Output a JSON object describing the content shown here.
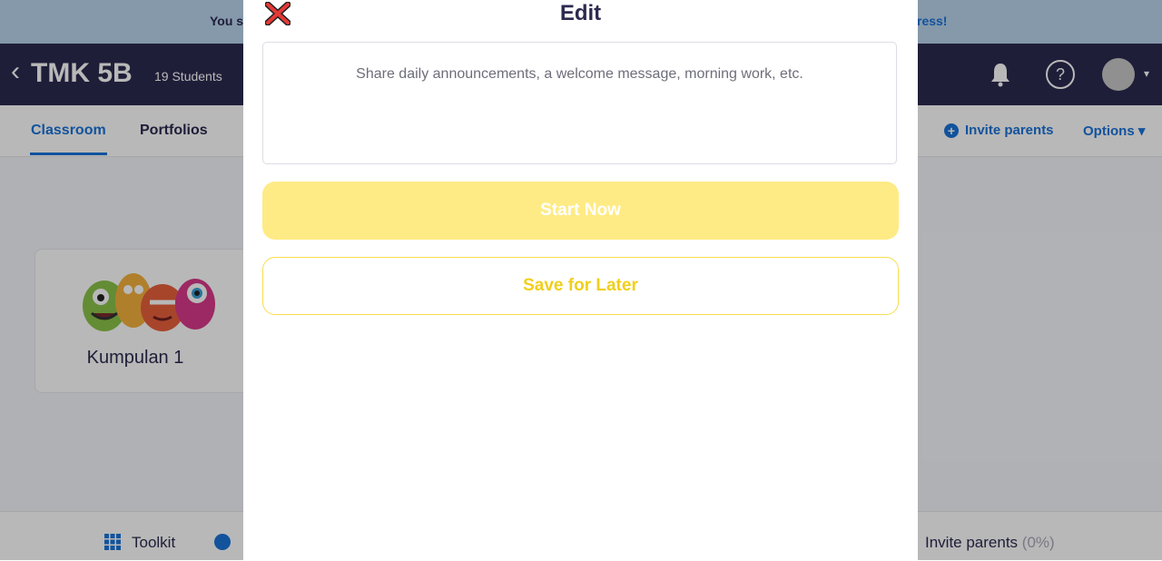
{
  "banner": {
    "left_text": "You s",
    "right_link": "ress!"
  },
  "header": {
    "back_icon": "chevron-left-icon",
    "back_glyph": "‹",
    "class_name": "TMK 5B",
    "students": "19 Students",
    "help_glyph": "?",
    "avatar_caret": "▾"
  },
  "nav": {
    "tabs": [
      {
        "label": "Classroom",
        "active": true
      },
      {
        "label": "Portfolios",
        "active": false
      }
    ],
    "invite_icon_glyph": "+",
    "invite_parents": "Invite parents",
    "options": "Options ▾"
  },
  "groups": [
    {
      "label": "Kumpulan 1",
      "icon": "monsters-group-icon"
    }
  ],
  "footer": {
    "toolkit": "Toolkit",
    "invite_parents": "Invite parents",
    "invite_pct": "(0%)"
  },
  "modal": {
    "title": "Edit",
    "close_icon": "close-icon",
    "textarea_placeholder": "Share daily announcements, a welcome message, morning work, etc.",
    "start_now": "Start Now",
    "save_for_later": "Save for Later"
  },
  "colors": {
    "brand_navy": "#2c2a50",
    "brand_blue": "#1a73d9",
    "yellow_light": "#ffeb85",
    "yellow_border": "#f7dd4e",
    "yellow_text": "#f1cf1a",
    "close_red": "#e53935"
  }
}
